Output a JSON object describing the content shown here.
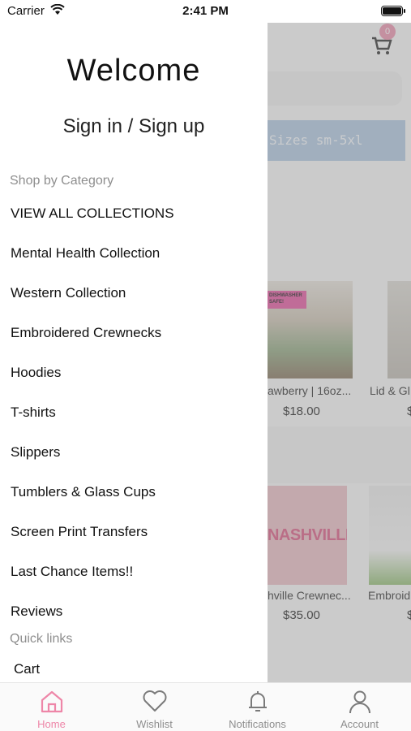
{
  "status_bar": {
    "carrier": "Carrier",
    "time": "2:41 PM"
  },
  "background": {
    "cart_badge": "0",
    "promo_text": "Sizes sm-5xl",
    "products_row1": [
      {
        "name": "awberry | 16oz...",
        "price": "$18.00",
        "tag": "DISHWASHER SAFE!"
      },
      {
        "name": "Lid & Gl",
        "price": "$"
      }
    ],
    "products_row2": [
      {
        "name": "hville Crewnec...",
        "price": "$35.00",
        "shirt_text": "NASHVILLE"
      },
      {
        "name": "Embroid",
        "price": "$"
      }
    ]
  },
  "drawer": {
    "welcome": "Welcome",
    "signin": "Sign in / Sign up",
    "shop_heading": "Shop by Category",
    "categories": [
      "VIEW ALL COLLECTIONS",
      "Mental Health Collection",
      "Western Collection",
      "Embroidered Crewnecks",
      "Hoodies",
      "T-shirts",
      "Slippers",
      "Tumblers & Glass Cups",
      "Screen Print Transfers",
      "Last Chance Items!!",
      "Reviews"
    ],
    "quick_links_heading": "Quick links",
    "quick_links": [
      "Cart"
    ]
  },
  "tabs": [
    {
      "label": "Home",
      "icon": "home-icon",
      "active": true
    },
    {
      "label": "Wishlist",
      "icon": "heart-icon",
      "active": false
    },
    {
      "label": "Notifications",
      "icon": "bell-icon",
      "active": false
    },
    {
      "label": "Account",
      "icon": "person-icon",
      "active": false
    }
  ],
  "colors": {
    "accent": "#ee86a8",
    "promo": "#a9c4de",
    "muted_text": "#8e8e8e"
  }
}
